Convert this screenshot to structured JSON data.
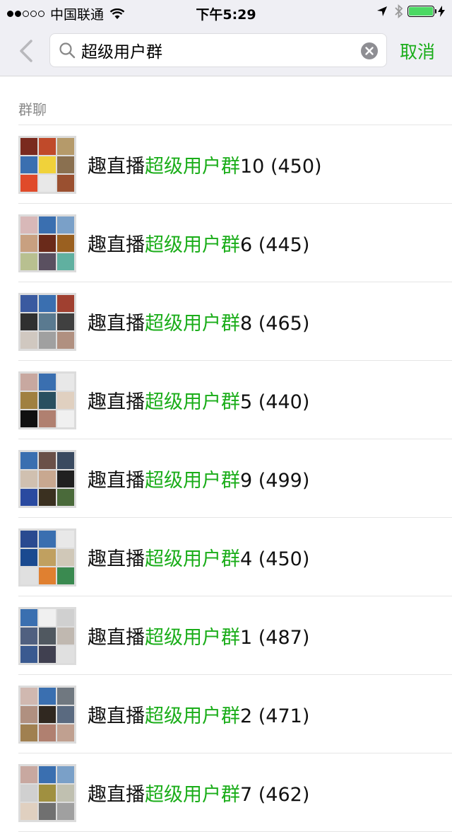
{
  "status_bar": {
    "carrier": "中国联通",
    "time": "下午5:29",
    "signal_full": 2,
    "signal_total": 5,
    "battery_level": 1.0,
    "battery_color": "#4cd964"
  },
  "search": {
    "query": "超级用户群",
    "cancel_label": "取消",
    "accent_color": "#1aad19"
  },
  "section": {
    "title": "群聊"
  },
  "results": [
    {
      "prefix": "趣直播",
      "highlight": "超级用户群",
      "suffix": "10 (450)",
      "avatar_colors": [
        "#7a2a1e",
        "#c04a2a",
        "#b59a6a",
        "#3a6fb0",
        "#f0d23a",
        "#8a7050",
        "#e04a2a",
        "#e8e8e8",
        "#9a5030"
      ]
    },
    {
      "prefix": "趣直播",
      "highlight": "超级用户群",
      "suffix": "6 (445)",
      "avatar_colors": [
        "#d8b8b8",
        "#3a6fb0",
        "#7aa0c8",
        "#c8a080",
        "#6a2a1a",
        "#9a6020",
        "#b8c090",
        "#5a5060",
        "#60b0a0"
      ]
    },
    {
      "prefix": "趣直播",
      "highlight": "超级用户群",
      "suffix": "8 (465)",
      "avatar_colors": [
        "#3a5aa0",
        "#3a6fb0",
        "#a04030",
        "#303030",
        "#5a7a90",
        "#404040",
        "#d0c8c0",
        "#a0a0a0",
        "#b09080"
      ]
    },
    {
      "prefix": "趣直播",
      "highlight": "超级用户群",
      "suffix": "5 (440)",
      "avatar_colors": [
        "#c8a8a0",
        "#3a6fb0",
        "#e8e8e8",
        "#a08040",
        "#2a5060",
        "#e0d0c0",
        "#101010",
        "#b08070",
        "#f0f0f0"
      ]
    },
    {
      "prefix": "趣直播",
      "highlight": "超级用户群",
      "suffix": "9 (499)",
      "avatar_colors": [
        "#3a6fb0",
        "#6a5048",
        "#3a4a60",
        "#d0c0b0",
        "#c8a890",
        "#202020",
        "#2a4aa0",
        "#3a3020",
        "#4a6a3a"
      ]
    },
    {
      "prefix": "趣直播",
      "highlight": "超级用户群",
      "suffix": "4 (450)",
      "avatar_colors": [
        "#2a4a90",
        "#3a6fb0",
        "#e8e8e8",
        "#1a4a90",
        "#c0a060",
        "#d0c8b8",
        "#e0e0e0",
        "#e08030",
        "#3a8a50"
      ]
    },
    {
      "prefix": "趣直播",
      "highlight": "超级用户群",
      "suffix": "1 (487)",
      "avatar_colors": [
        "#3a6fb0",
        "#f0f0f0",
        "#d0d0d0",
        "#506080",
        "#505860",
        "#c0b8b0",
        "#3a5a90",
        "#404050",
        "#e0e0e0"
      ]
    },
    {
      "prefix": "趣直播",
      "highlight": "超级用户群",
      "suffix": "2 (471)",
      "avatar_colors": [
        "#d0b8b0",
        "#3a6fb0",
        "#707880",
        "#b09080",
        "#302820",
        "#5a6a80",
        "#a08050",
        "#b08070",
        "#c0a090"
      ]
    },
    {
      "prefix": "趣直播",
      "highlight": "超级用户群",
      "suffix": "7 (462)",
      "avatar_colors": [
        "#c8a8a0",
        "#3a6fb0",
        "#7aa0c8",
        "#d0d0d0",
        "#a09040",
        "#c0c0b0",
        "#e0d0c0",
        "#707070",
        "#a0a0a0"
      ]
    }
  ]
}
